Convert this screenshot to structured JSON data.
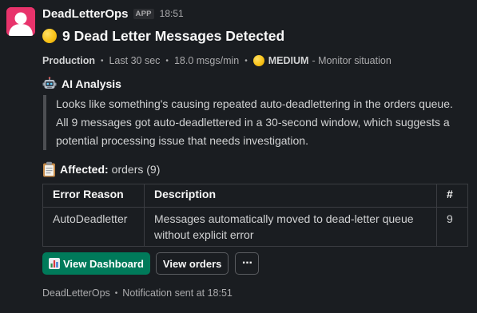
{
  "message": {
    "app_name": "DeadLetterOps",
    "app_badge": "APP",
    "time": "18:51",
    "title": "9 Dead Letter Messages Detected",
    "meta": {
      "environment": "Production",
      "window": "Last 30 sec",
      "rate": "18.0 msgs/min",
      "severity": "MEDIUM",
      "severity_action": "- Monitor situation",
      "severity_color": "#f9c31a"
    },
    "ai_analysis": {
      "heading": "AI Analysis",
      "text": "Looks like something's causing repeated auto-deadlettering in the orders queue. All 9 messages got auto-deadlettered in a 30-second window, which suggests a potential processing issue that needs investigation."
    },
    "affected": {
      "label": "Affected:",
      "value": "orders (9)"
    },
    "table": {
      "headers": [
        "Error Reason",
        "Description",
        "#"
      ],
      "rows": [
        [
          "AutoDeadletter",
          "Messages automatically moved to dead-letter queue without explicit error",
          "9"
        ]
      ]
    },
    "buttons": {
      "primary": "View Dashboard",
      "secondary": "View orders",
      "more": "···",
      "primary_color": "#007a5a"
    },
    "footer": {
      "source": "DeadLetterOps",
      "status": "Notification sent at 18:51"
    },
    "icons": {
      "avatar": "dead-letter-ops-logo",
      "title_icon": "yellow-circle-icon",
      "ai_icon": "robot-icon",
      "affected_icon": "clipboard-icon",
      "primary_button_icon": "bar-chart-icon"
    }
  }
}
